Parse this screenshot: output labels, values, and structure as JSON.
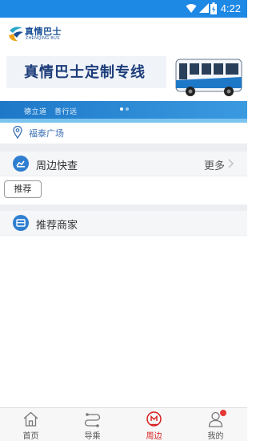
{
  "status_bar": {
    "time": "4:22"
  },
  "header": {
    "logo_cn": "真情巴士",
    "logo_en": "ZHENQING BUS"
  },
  "banner": {
    "headline": "真情巴士定制专线",
    "tagline": "德立道　善行远"
  },
  "location": {
    "text": "福泰广场"
  },
  "quick_check": {
    "title": "周边快查",
    "more_label": "更多",
    "tag_label": "推荐"
  },
  "merchants": {
    "title": "推荐商家"
  },
  "bottom_nav": {
    "items": [
      {
        "label": "首页",
        "icon": "home-icon"
      },
      {
        "label": "导乘",
        "icon": "route-icon"
      },
      {
        "label": "周边",
        "icon": "nearby-icon"
      },
      {
        "label": "我的",
        "icon": "profile-icon"
      }
    ],
    "active_index": 2
  },
  "colors": {
    "status_bar": "#1e88e5",
    "accent_blue": "#2f7fd0",
    "active_red": "#d81e1e"
  }
}
